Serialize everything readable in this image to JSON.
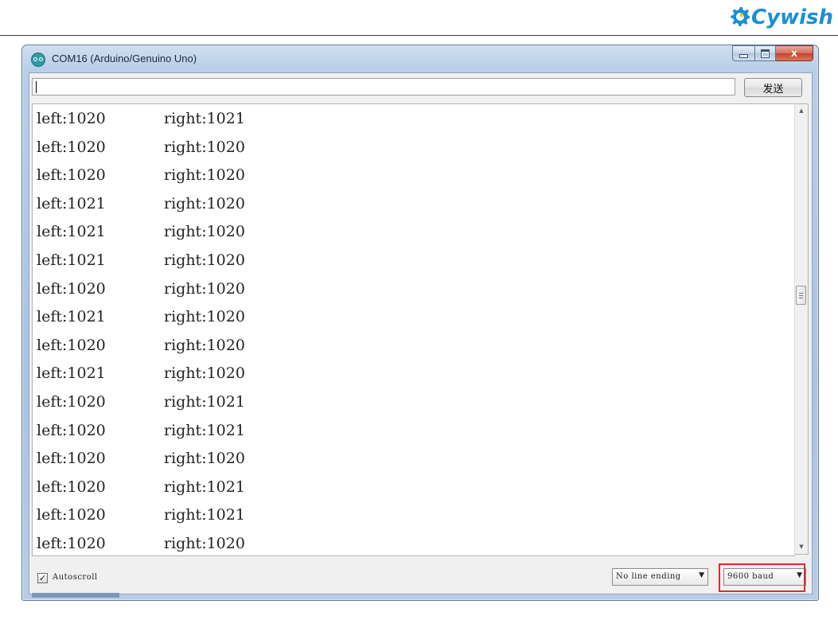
{
  "brand": {
    "name": "Keywish",
    "text": "Cywish",
    "color": "#1a8fd6"
  },
  "window": {
    "title": "COM16 (Arduino/Genuino Uno)",
    "app_icon": "arduino-icon",
    "controls": {
      "minimize_icon": "minimize-icon",
      "maximize_icon": "maximize-icon",
      "close_glyph": "x"
    }
  },
  "send": {
    "input_value": "",
    "button_label": "发送"
  },
  "output": {
    "lines": [
      {
        "left": "left:1020",
        "right": "right:1021"
      },
      {
        "left": "left:1020",
        "right": "right:1020"
      },
      {
        "left": "left:1020",
        "right": "right:1020"
      },
      {
        "left": "left:1021",
        "right": "right:1020"
      },
      {
        "left": "left:1021",
        "right": "right:1020"
      },
      {
        "left": "left:1021",
        "right": "right:1020"
      },
      {
        "left": "left:1020",
        "right": "right:1020"
      },
      {
        "left": "left:1021",
        "right": "right:1020"
      },
      {
        "left": "left:1020",
        "right": "right:1020"
      },
      {
        "left": "left:1021",
        "right": "right:1020"
      },
      {
        "left": "left:1020",
        "right": "right:1021"
      },
      {
        "left": "left:1020",
        "right": "right:1021"
      },
      {
        "left": "left:1020",
        "right": "right:1020"
      },
      {
        "left": "left:1020",
        "right": "right:1021"
      },
      {
        "left": "left:1020",
        "right": "right:1021"
      },
      {
        "left": "left:1020",
        "right": "right:1020"
      }
    ]
  },
  "footer": {
    "autoscroll_label": "Autoscroll",
    "autoscroll_checked": true,
    "line_ending": "No line ending",
    "baud_rate": "9600 baud",
    "highlight_color": "#e0282c"
  }
}
